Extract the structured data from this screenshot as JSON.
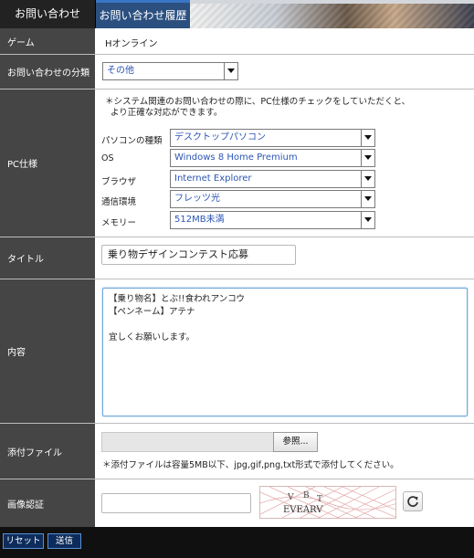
{
  "tabs": [
    {
      "label": "お問い合わせ"
    },
    {
      "label": "お問い合わせ履歴"
    }
  ],
  "form": {
    "game": {
      "label": "ゲーム",
      "value": "Hオンライン"
    },
    "category": {
      "label": "お問い合わせの分類",
      "value": "その他"
    },
    "pc": {
      "label": "PC仕様",
      "note_line1": "＊システム関連のお問い合わせの際に、PC仕様のチェックをしていただくと、",
      "note_line2": "より正確な対応ができます。",
      "fields": [
        {
          "label": "パソコンの種類",
          "value": "デスクトップパソコン"
        },
        {
          "label": "OS",
          "value": "Windows 8 Home Premium"
        },
        {
          "label": "ブラウザ",
          "value": "Internet Explorer"
        },
        {
          "label": "通信環境",
          "value": "フレッツ光"
        },
        {
          "label": "メモリー",
          "value": "512MB未満"
        }
      ]
    },
    "title": {
      "label": "タイトル",
      "value": "乗り物デザインコンテスト応募"
    },
    "body": {
      "label": "内容",
      "value": "【乗り物名】とぶ!!食われアンコウ\n【ペンネーム】アテナ\n\n宜しくお願いします。"
    },
    "attachment": {
      "label": "添付ファイル",
      "browse_label": "参照...",
      "note": "＊添付ファイルは容量5MB以下、jpg,gif,png,txt形式で添付してください。"
    },
    "captcha": {
      "label": "画像認証",
      "value": "",
      "image_text": "EVEARV"
    }
  },
  "footer": {
    "reset_label": "リセット",
    "submit_label": "送信"
  }
}
